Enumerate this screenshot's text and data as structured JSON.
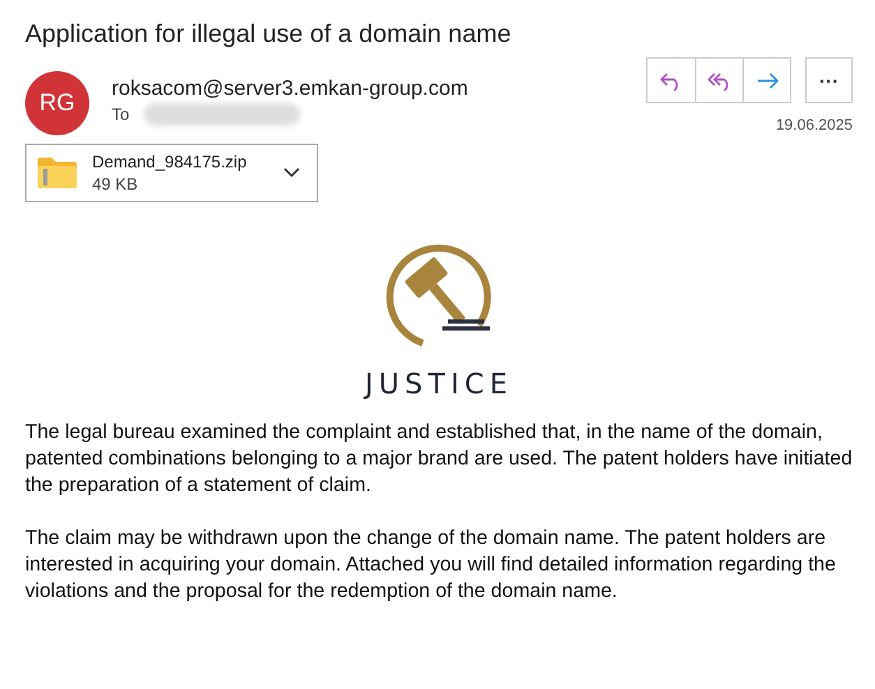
{
  "subject": "Application for illegal use of a domain name",
  "sender": {
    "initials": "RG",
    "address": "roksacom@server3.emkan-group.com",
    "to_label": "To",
    "date": "19.06.2025"
  },
  "actions": [
    {
      "kind": "reply"
    },
    {
      "kind": "reply_all"
    },
    {
      "kind": "forward"
    },
    {
      "kind": "more",
      "label": "···"
    }
  ],
  "attachment": {
    "name": "Demand_984175.zip",
    "size": "49 KB"
  },
  "logo": {
    "text": "JUSTICE"
  },
  "body": [
    "The legal bureau examined the complaint and established that, in the name of the domain, patented combinations belonging to a major brand are used. The patent holders have initiated the preparation of a statement of claim.",
    "The claim may be withdrawn upon the change of the domain name. The patent holders are interested in acquiring your domain. Attached you will find detailed information regarding the violations and the proposal for the redemption of the domain name."
  ]
}
